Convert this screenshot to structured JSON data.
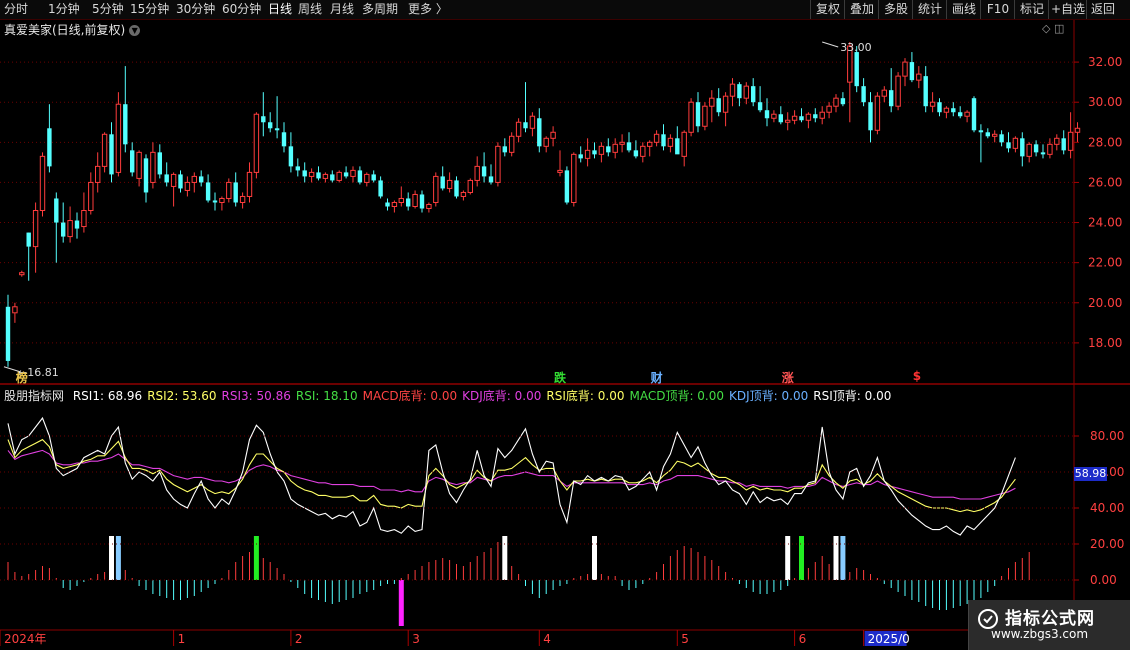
{
  "toolbar": {
    "left": [
      "分时",
      "1分钟",
      "5分钟",
      "15分钟",
      "30分钟",
      "60分钟",
      "日线",
      "周线",
      "月线",
      "多周期",
      "更多 〉"
    ],
    "active_index": 6,
    "right": [
      "复权",
      "叠加",
      "多股",
      "统计",
      "画线",
      "F10",
      "+自选",
      "返回"
    ],
    "right_extra": "标记"
  },
  "stock": {
    "title": "真爱美家(日线,前复权)",
    "high_label": "33.00",
    "low_label": "16.81"
  },
  "price_axis": [
    "32.00",
    "30.00",
    "28.00",
    "26.00",
    "24.00",
    "22.00",
    "20.00",
    "18.00"
  ],
  "price_range": [
    16.0,
    33.6
  ],
  "badges": [
    {
      "label": "榜",
      "color": "#e8c24a",
      "x_index": 2
    },
    {
      "label": "跌",
      "color": "#33dd33",
      "x_index": 80
    },
    {
      "label": "财",
      "color": "#6ab0ff",
      "x_index": 94
    },
    {
      "label": "涨",
      "color": "#ff5555",
      "x_index": 113
    },
    {
      "label": "$",
      "color": "#ff3333",
      "x_index": 132
    }
  ],
  "indicator": {
    "name": "股朋指标网",
    "legend": [
      {
        "label": "RSI1: 68.96",
        "color": "#ffffff"
      },
      {
        "label": "RSI2: 53.60",
        "color": "#ffff66"
      },
      {
        "label": "RSI3: 50.86",
        "color": "#e040e0"
      },
      {
        "label": "RSI: 18.10",
        "color": "#44dd44"
      },
      {
        "label": "MACD底背: 0.00",
        "color": "#ff4444"
      },
      {
        "label": "KDJ底背: 0.00",
        "color": "#e040e0"
      },
      {
        "label": "RSI底背: 0.00",
        "color": "#ffff66"
      },
      {
        "label": "MACD顶背: 0.00",
        "color": "#44dd44"
      },
      {
        "label": "KDJ顶背: 0.00",
        "color": "#6ab0ff"
      },
      {
        "label": "RSI顶背: 0.00",
        "color": "#ffffff"
      }
    ],
    "axis": [
      "80.00",
      "60.00",
      "40.00",
      "20.00",
      "0.00"
    ],
    "current_value": "58.98"
  },
  "time_axis": [
    {
      "label": "2024年",
      "x_index": 0
    },
    {
      "label": "1",
      "x_index": 24
    },
    {
      "label": "2",
      "x_index": 41
    },
    {
      "label": "3",
      "x_index": 58
    },
    {
      "label": "4",
      "x_index": 77
    },
    {
      "label": "5",
      "x_index": 97
    },
    {
      "label": "6",
      "x_index": 114
    },
    {
      "label": "2025/0",
      "x_index": 124
    }
  ],
  "watermark": {
    "line1": "指标公式网",
    "line2": "www.zbgs3.com"
  },
  "colors": {
    "up": "#ff3c3c",
    "down": "#54ffff",
    "grid": "#6b0000",
    "axis_text": "#ff4040"
  },
  "candles": [
    [
      19.8,
      20.4,
      16.81,
      17.1
    ],
    [
      19.5,
      20.0,
      19.0,
      19.8
    ],
    [
      21.4,
      21.6,
      21.3,
      21.5
    ],
    [
      23.5,
      23.5,
      21.1,
      22.8
    ],
    [
      22.8,
      25.0,
      21.5,
      24.6
    ],
    [
      24.6,
      27.5,
      24.3,
      27.3
    ],
    [
      28.7,
      29.9,
      26.5,
      26.8
    ],
    [
      25.2,
      25.5,
      22.0,
      24.0
    ],
    [
      24.0,
      25.0,
      23.0,
      23.3
    ],
    [
      23.3,
      24.8,
      23.0,
      24.1
    ],
    [
      24.1,
      24.5,
      23.2,
      23.7
    ],
    [
      23.8,
      25.5,
      23.5,
      24.6
    ],
    [
      24.6,
      26.5,
      24.4,
      26.0
    ],
    [
      26.0,
      27.5,
      25.5,
      26.8
    ],
    [
      26.8,
      28.5,
      26.5,
      28.4
    ],
    [
      28.4,
      29.0,
      26.0,
      26.4
    ],
    [
      26.5,
      30.5,
      26.3,
      29.9
    ],
    [
      29.9,
      31.8,
      27.5,
      27.9
    ],
    [
      27.6,
      28.0,
      26.3,
      26.5
    ],
    [
      26.2,
      27.6,
      25.8,
      27.5
    ],
    [
      27.2,
      27.4,
      25.0,
      25.5
    ],
    [
      26.0,
      28.0,
      25.7,
      27.5
    ],
    [
      27.5,
      27.9,
      26.2,
      26.4
    ],
    [
      26.4,
      27.0,
      25.8,
      26.0
    ],
    [
      25.8,
      26.5,
      24.8,
      26.4
    ],
    [
      26.4,
      26.6,
      25.5,
      25.7
    ],
    [
      25.6,
      26.3,
      25.3,
      26.0
    ],
    [
      26.0,
      26.5,
      25.5,
      26.3
    ],
    [
      26.3,
      26.6,
      25.8,
      26.0
    ],
    [
      26.0,
      26.4,
      25.0,
      25.1
    ],
    [
      25.1,
      25.5,
      24.6,
      25.0
    ],
    [
      25.0,
      25.3,
      24.6,
      25.2
    ],
    [
      25.2,
      26.2,
      25.0,
      26.0
    ],
    [
      26.0,
      26.5,
      24.8,
      25.0
    ],
    [
      25.0,
      25.5,
      24.7,
      25.3
    ],
    [
      25.3,
      27.0,
      25.0,
      26.5
    ],
    [
      26.5,
      29.5,
      26.2,
      29.4
    ],
    [
      29.3,
      30.5,
      28.3,
      29.0
    ],
    [
      29.0,
      29.5,
      28.5,
      28.7
    ],
    [
      28.7,
      30.3,
      28.2,
      28.6
    ],
    [
      28.5,
      29.0,
      27.5,
      27.8
    ],
    [
      27.8,
      28.5,
      26.5,
      26.8
    ],
    [
      26.8,
      27.2,
      26.3,
      26.6
    ],
    [
      26.6,
      27.0,
      26.0,
      26.3
    ],
    [
      26.3,
      26.7,
      26.0,
      26.5
    ],
    [
      26.5,
      26.8,
      26.1,
      26.2
    ],
    [
      26.2,
      26.5,
      26.0,
      26.4
    ],
    [
      26.4,
      26.6,
      26.0,
      26.1
    ],
    [
      26.1,
      26.6,
      26.0,
      26.5
    ],
    [
      26.5,
      26.8,
      26.2,
      26.3
    ],
    [
      26.3,
      26.8,
      26.0,
      26.6
    ],
    [
      26.6,
      26.8,
      25.9,
      26.0
    ],
    [
      26.0,
      26.5,
      25.8,
      26.4
    ],
    [
      26.4,
      26.6,
      26.0,
      26.1
    ],
    [
      26.1,
      26.3,
      25.2,
      25.3
    ],
    [
      25.0,
      25.2,
      24.6,
      24.8
    ],
    [
      24.8,
      25.1,
      24.5,
      25.0
    ],
    [
      25.0,
      25.8,
      24.8,
      25.2
    ],
    [
      25.2,
      25.5,
      24.6,
      24.8
    ],
    [
      24.8,
      25.6,
      24.7,
      25.4
    ],
    [
      25.4,
      25.6,
      24.5,
      24.7
    ],
    [
      24.7,
      25.0,
      24.5,
      24.9
    ],
    [
      25.0,
      26.5,
      24.8,
      26.3
    ],
    [
      26.3,
      26.8,
      25.6,
      25.7
    ],
    [
      25.7,
      26.5,
      25.5,
      26.1
    ],
    [
      26.1,
      26.3,
      25.2,
      25.3
    ],
    [
      25.3,
      25.6,
      25.1,
      25.5
    ],
    [
      25.5,
      26.2,
      25.4,
      26.1
    ],
    [
      26.1,
      27.3,
      25.8,
      26.8
    ],
    [
      26.8,
      27.5,
      26.0,
      26.3
    ],
    [
      26.3,
      26.9,
      25.9,
      26.0
    ],
    [
      26.0,
      28.0,
      25.8,
      27.8
    ],
    [
      27.8,
      28.2,
      27.3,
      27.5
    ],
    [
      27.5,
      28.5,
      27.3,
      28.3
    ],
    [
      28.3,
      29.2,
      28.0,
      29.0
    ],
    [
      29.0,
      31.0,
      28.5,
      28.7
    ],
    [
      28.7,
      29.5,
      28.3,
      29.3
    ],
    [
      29.2,
      29.7,
      27.5,
      27.8
    ],
    [
      27.8,
      28.3,
      27.5,
      28.2
    ],
    [
      28.2,
      28.8,
      27.8,
      28.5
    ],
    [
      26.5,
      27.6,
      26.3,
      26.6
    ],
    [
      26.6,
      26.8,
      24.9,
      25.0
    ],
    [
      25.0,
      27.5,
      24.8,
      27.4
    ],
    [
      27.4,
      27.8,
      27.0,
      27.2
    ],
    [
      27.2,
      28.2,
      26.8,
      27.6
    ],
    [
      27.6,
      28.0,
      27.2,
      27.4
    ],
    [
      27.4,
      28.0,
      27.0,
      27.8
    ],
    [
      27.8,
      28.2,
      27.3,
      27.5
    ],
    [
      27.5,
      28.2,
      27.2,
      27.9
    ],
    [
      27.9,
      28.4,
      27.5,
      28.0
    ],
    [
      28.0,
      28.5,
      27.5,
      27.6
    ],
    [
      27.6,
      28.1,
      27.2,
      27.3
    ],
    [
      27.3,
      28.0,
      27.0,
      27.8
    ],
    [
      27.8,
      28.1,
      27.3,
      28.0
    ],
    [
      28.0,
      28.6,
      27.8,
      28.4
    ],
    [
      28.4,
      28.9,
      27.6,
      27.8
    ],
    [
      27.8,
      28.4,
      27.5,
      28.2
    ],
    [
      28.2,
      28.8,
      28.0,
      27.4
    ],
    [
      27.3,
      28.6,
      26.8,
      28.5
    ],
    [
      28.5,
      30.2,
      28.3,
      30.0
    ],
    [
      30.0,
      30.5,
      28.5,
      28.8
    ],
    [
      28.8,
      30.0,
      28.6,
      29.8
    ],
    [
      29.8,
      30.6,
      29.0,
      30.2
    ],
    [
      30.2,
      30.7,
      29.3,
      29.5
    ],
    [
      29.5,
      30.5,
      28.8,
      30.3
    ],
    [
      30.3,
      31.2,
      29.8,
      30.9
    ],
    [
      30.9,
      31.0,
      29.8,
      30.2
    ],
    [
      30.2,
      31.0,
      29.9,
      30.8
    ],
    [
      30.8,
      31.2,
      29.8,
      30.0
    ],
    [
      30.0,
      30.8,
      29.5,
      29.6
    ],
    [
      29.6,
      30.2,
      28.8,
      29.2
    ],
    [
      29.2,
      29.6,
      29.0,
      29.4
    ],
    [
      29.4,
      29.8,
      28.9,
      29.0
    ],
    [
      29.0,
      29.5,
      28.6,
      29.1
    ],
    [
      29.1,
      29.6,
      28.9,
      29.3
    ],
    [
      29.3,
      29.7,
      29.0,
      29.1
    ],
    [
      29.1,
      29.5,
      28.7,
      29.4
    ],
    [
      29.4,
      29.7,
      29.0,
      29.2
    ],
    [
      29.2,
      29.8,
      28.9,
      29.5
    ],
    [
      29.5,
      30.0,
      29.2,
      29.8
    ],
    [
      29.8,
      30.4,
      29.5,
      30.2
    ],
    [
      30.2,
      30.5,
      29.8,
      29.9
    ],
    [
      31.0,
      33.0,
      29.0,
      32.8
    ],
    [
      32.5,
      32.8,
      30.5,
      30.8
    ],
    [
      30.8,
      31.2,
      29.8,
      30.0
    ],
    [
      30.0,
      30.5,
      28.0,
      28.6
    ],
    [
      28.6,
      30.5,
      28.4,
      30.3
    ],
    [
      30.3,
      30.8,
      30.0,
      30.6
    ],
    [
      30.6,
      31.7,
      29.5,
      29.8
    ],
    [
      29.8,
      31.5,
      29.6,
      31.3
    ],
    [
      31.3,
      32.2,
      30.8,
      32.0
    ],
    [
      32.0,
      32.5,
      31.0,
      31.1
    ],
    [
      31.1,
      31.8,
      30.7,
      31.4
    ],
    [
      31.3,
      31.8,
      29.5,
      29.8
    ],
    [
      29.8,
      30.5,
      29.5,
      30.0
    ],
    [
      30.0,
      30.2,
      29.3,
      29.5
    ],
    [
      29.5,
      29.8,
      29.2,
      29.7
    ],
    [
      29.7,
      30.0,
      29.3,
      29.5
    ],
    [
      29.5,
      29.8,
      29.2,
      29.3
    ],
    [
      29.3,
      29.6,
      29.0,
      29.5
    ],
    [
      30.2,
      30.3,
      28.5,
      28.6
    ],
    [
      28.6,
      28.9,
      27.0,
      28.5
    ],
    [
      28.5,
      28.7,
      28.2,
      28.3
    ],
    [
      28.3,
      28.6,
      28.0,
      28.4
    ],
    [
      28.4,
      28.6,
      27.8,
      28.0
    ],
    [
      28.0,
      28.5,
      27.5,
      27.7
    ],
    [
      27.7,
      28.3,
      27.5,
      28.2
    ],
    [
      28.2,
      28.5,
      26.8,
      27.3
    ],
    [
      27.3,
      28.0,
      27.0,
      27.9
    ],
    [
      27.9,
      28.1,
      27.3,
      27.5
    ],
    [
      27.5,
      27.9,
      27.2,
      27.4
    ],
    [
      27.4,
      28.2,
      27.2,
      27.9
    ],
    [
      27.9,
      28.4,
      27.6,
      28.2
    ],
    [
      28.2,
      28.6,
      27.4,
      27.6
    ],
    [
      27.6,
      29.5,
      27.2,
      28.5
    ],
    [
      28.5,
      29.0,
      28.0,
      28.7
    ]
  ],
  "rsi1": [
    87,
    70,
    78,
    80,
    85,
    90,
    80,
    62,
    58,
    60,
    62,
    68,
    70,
    72,
    70,
    80,
    85,
    65,
    56,
    60,
    58,
    55,
    60,
    50,
    45,
    42,
    40,
    48,
    55,
    45,
    40,
    45,
    42,
    50,
    60,
    78,
    86,
    82,
    70,
    60,
    55,
    45,
    42,
    40,
    38,
    36,
    37,
    34,
    36,
    35,
    38,
    30,
    32,
    40,
    28,
    27,
    28,
    26,
    30,
    27,
    28,
    72,
    75,
    60,
    48,
    43,
    50,
    56,
    72,
    58,
    52,
    73,
    68,
    72,
    78,
    84,
    70,
    60,
    66,
    65,
    42,
    32,
    55,
    53,
    58,
    55,
    57,
    55,
    58,
    57,
    50,
    52,
    56,
    60,
    50,
    63,
    70,
    82,
    75,
    68,
    74,
    65,
    58,
    53,
    55,
    50,
    48,
    42,
    49,
    43,
    46,
    44,
    45,
    42,
    48,
    48,
    54,
    55,
    85,
    60,
    50,
    45,
    60,
    62,
    52,
    58,
    68,
    55,
    50,
    44,
    40,
    36,
    33,
    30,
    28,
    28,
    30,
    27,
    25,
    30,
    28,
    32,
    36,
    40,
    48,
    58,
    68
  ],
  "rsi2": [
    78,
    68,
    72,
    74,
    76,
    78,
    74,
    64,
    62,
    63,
    64,
    66,
    67,
    69,
    69,
    73,
    77,
    68,
    62,
    62,
    61,
    59,
    61,
    56,
    53,
    51,
    49,
    51,
    53,
    50,
    48,
    49,
    48,
    51,
    56,
    64,
    70,
    70,
    66,
    62,
    60,
    55,
    52,
    50,
    49,
    47,
    47,
    46,
    46,
    46,
    47,
    44,
    44,
    47,
    42,
    41,
    41,
    40,
    42,
    41,
    41,
    58,
    62,
    58,
    53,
    51,
    53,
    55,
    61,
    57,
    55,
    61,
    61,
    62,
    65,
    68,
    64,
    61,
    62,
    62,
    55,
    50,
    55,
    55,
    56,
    55,
    56,
    55,
    56,
    56,
    54,
    54,
    55,
    57,
    54,
    58,
    61,
    66,
    65,
    63,
    65,
    62,
    59,
    57,
    57,
    55,
    53,
    50,
    52,
    50,
    51,
    50,
    50,
    49,
    51,
    51,
    53,
    54,
    64,
    58,
    54,
    51,
    55,
    56,
    53,
    55,
    59,
    55,
    52,
    49,
    47,
    45,
    43,
    41,
    40,
    40,
    40,
    39,
    38,
    39,
    38,
    39,
    41,
    43,
    46,
    51,
    56
  ],
  "rsi3": [
    72,
    67,
    69,
    70,
    71,
    72,
    70,
    65,
    64,
    64,
    65,
    65,
    66,
    66,
    67,
    68,
    70,
    67,
    64,
    64,
    63,
    62,
    62,
    60,
    58,
    57,
    56,
    57,
    57,
    56,
    55,
    55,
    54,
    55,
    57,
    61,
    63,
    64,
    63,
    61,
    60,
    58,
    57,
    56,
    55,
    54,
    54,
    53,
    53,
    53,
    53,
    52,
    52,
    52,
    50,
    50,
    50,
    49,
    50,
    49,
    49,
    55,
    57,
    56,
    54,
    53,
    54,
    54,
    57,
    56,
    55,
    57,
    58,
    58,
    59,
    60,
    59,
    58,
    58,
    58,
    55,
    52,
    54,
    54,
    54,
    54,
    54,
    54,
    54,
    54,
    53,
    53,
    53,
    54,
    53,
    55,
    56,
    58,
    58,
    58,
    58,
    57,
    56,
    55,
    55,
    54,
    54,
    52,
    53,
    52,
    52,
    52,
    52,
    51,
    52,
    52,
    52,
    53,
    57,
    55,
    53,
    52,
    53,
    54,
    53,
    53,
    55,
    53,
    52,
    51,
    50,
    49,
    48,
    47,
    46,
    46,
    46,
    46,
    45,
    45,
    45,
    45,
    46,
    47,
    48,
    49,
    51
  ],
  "macd": [
    0.9,
    0.4,
    0.2,
    0.3,
    0.5,
    0.7,
    0.6,
    0.1,
    -0.4,
    -0.5,
    -0.3,
    -0.1,
    0.1,
    0.3,
    0.4,
    0.6,
    0.8,
    0.5,
    0.1,
    -0.3,
    -0.5,
    -0.7,
    -0.8,
    -0.9,
    -1.0,
    -1.0,
    -0.9,
    -0.8,
    -0.6,
    -0.4,
    -0.2,
    0.1,
    0.5,
    0.9,
    1.2,
    1.4,
    1.3,
    1.1,
    0.9,
    0.6,
    0.3,
    -0.1,
    -0.4,
    -0.7,
    -0.9,
    -1.0,
    -1.1,
    -1.2,
    -1.1,
    -1.0,
    -0.9,
    -0.7,
    -0.6,
    -0.5,
    -0.3,
    -0.2,
    -0.2,
    0.1,
    0.3,
    0.5,
    0.7,
    0.9,
    1.0,
    1.1,
    1.0,
    0.8,
    0.7,
    0.9,
    1.2,
    1.4,
    1.6,
    1.9,
    1.2,
    0.7,
    0.3,
    -0.3,
    -0.7,
    -0.9,
    -0.7,
    -0.5,
    -0.3,
    -0.2,
    0.1,
    0.2,
    0.3,
    0.4,
    0.3,
    0.2,
    0.2,
    -0.3,
    -0.5,
    -0.4,
    -0.2,
    0.1,
    0.4,
    0.8,
    1.2,
    1.5,
    1.7,
    1.6,
    1.4,
    1.2,
    1.0,
    0.7,
    0.4,
    0.1,
    -0.2,
    -0.4,
    -0.6,
    -0.7,
    -0.7,
    -0.6,
    -0.5,
    -0.3,
    0.1,
    0.3,
    0.6,
    0.9,
    1.2,
    0.8,
    0.5,
    0.2,
    0.4,
    0.6,
    0.5,
    0.3,
    0.1,
    -0.2,
    -0.4,
    -0.6,
    -0.8,
    -1.0,
    -1.1,
    -1.3,
    -1.4,
    -1.5,
    -1.5,
    -1.4,
    -1.3,
    -1.2,
    -1.0,
    -0.9,
    -0.6,
    -0.3,
    0.2,
    0.6,
    0.9,
    1.1,
    1.4
  ],
  "signals": [
    {
      "x_index": 15,
      "color": "#ffffff"
    },
    {
      "x_index": 16,
      "color": "#88ccff"
    },
    {
      "x_index": 36,
      "color": "#22ee22"
    },
    {
      "x_index": 57,
      "color": "#ff22ff",
      "down": true
    },
    {
      "x_index": 72,
      "color": "#ffffff"
    },
    {
      "x_index": 85,
      "color": "#ffffff"
    },
    {
      "x_index": 113,
      "color": "#ffffff"
    },
    {
      "x_index": 115,
      "color": "#22ee22"
    },
    {
      "x_index": 120,
      "color": "#ffffff"
    },
    {
      "x_index": 121,
      "color": "#88ccff"
    }
  ]
}
